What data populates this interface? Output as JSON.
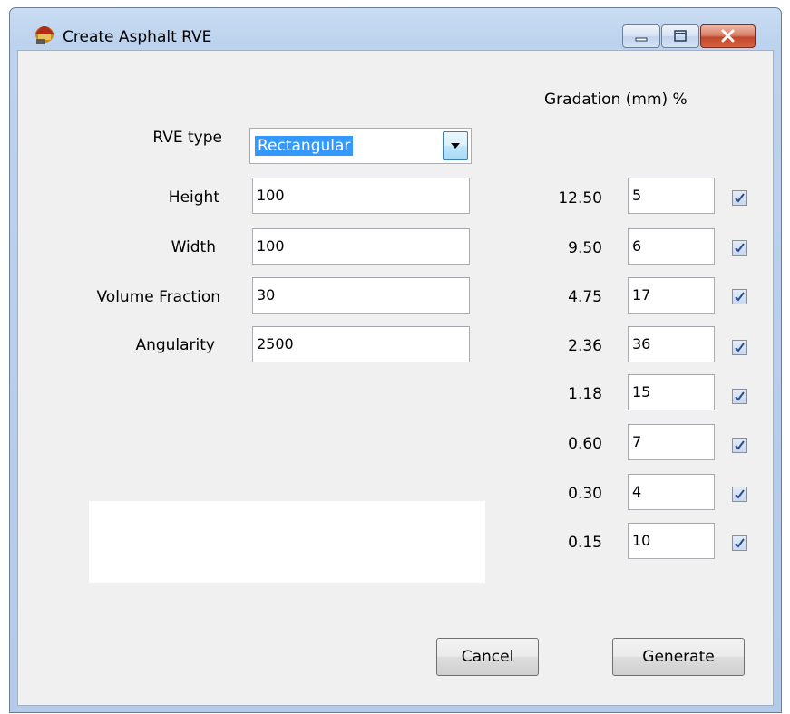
{
  "window": {
    "title": "Create Asphalt RVE",
    "icon": "app-helmet-icon"
  },
  "form": {
    "gradation_header": "Gradation (mm) %",
    "rve_type_label": "RVE type",
    "rve_type_value": "Rectangular",
    "height_label": "Height",
    "height_value": "100",
    "width_label": "Width",
    "width_value": "100",
    "volume_fraction_label": "Volume Fraction",
    "volume_fraction_value": "30",
    "angularity_label": "Angularity",
    "angularity_value": "2500"
  },
  "gradation": [
    {
      "size": "12.50",
      "percent": "5",
      "checked": true
    },
    {
      "size": "9.50",
      "percent": "6",
      "checked": true
    },
    {
      "size": "4.75",
      "percent": "17",
      "checked": true
    },
    {
      "size": "2.36",
      "percent": "36",
      "checked": true
    },
    {
      "size": "1.18",
      "percent": "15",
      "checked": true
    },
    {
      "size": "0.60",
      "percent": "7",
      "checked": true
    },
    {
      "size": "0.30",
      "percent": "4",
      "checked": true
    },
    {
      "size": "0.15",
      "percent": "10",
      "checked": true
    }
  ],
  "buttons": {
    "cancel": "Cancel",
    "generate": "Generate"
  },
  "colors": {
    "selection": "#3399ff",
    "close_button": "#c1482c"
  }
}
